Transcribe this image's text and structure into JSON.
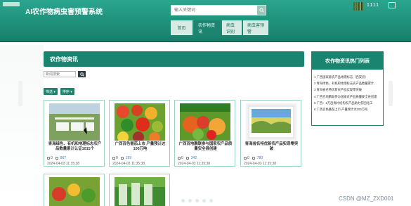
{
  "header": {
    "title": "AI农作物病虫害预警系统",
    "search_placeholder": "输入关键词",
    "username": "1111",
    "nav": [
      {
        "label": "首页",
        "active": false
      },
      {
        "label": "农作物资讯",
        "active": true
      },
      {
        "label": "病虫识别",
        "active": false
      },
      {
        "label": "病虫害预警",
        "active": false
      }
    ]
  },
  "main": {
    "section_title": "农作物资讯",
    "search_placeholder": "新闻搜索",
    "filters": [
      {
        "label": "筛选 ▾"
      },
      {
        "label": "排序 ▾"
      }
    ],
    "cards": [
      {
        "title": "青海绿色、有机和地理标志农产品数量累计认证1015个",
        "likes": "0",
        "views": "867",
        "date": "2024-04-03 11:35:38"
      },
      {
        "title": "广西百色番茄上市 产量预计达100万吨",
        "likes": "0",
        "views": "199",
        "date": "2024-04-03 11:35:38"
      },
      {
        "title": "广西百地鹏联参与国家农产品质量安全县创建",
        "likes": "0",
        "views": "342",
        "date": "2024-04-03 11:35:38"
      },
      {
        "title": "青海省名特优新农产品实现零突破",
        "likes": "0",
        "views": "780",
        "date": "2024-04-03 11:35:38"
      }
    ]
  },
  "sidebar": {
    "title": "农作物资讯热门列表",
    "items": [
      "1 广西国家级农产品地理标志（西安县）",
      "2 青海绿色、有机和地理标志农产品数量累计...",
      "3 青海省名特优新农产品实现零突破",
      "4 广西百地鹏联参与国家农产品质量安全县创建",
      "5 广西：2万亩梅片结构农产品助力贫困化工",
      "6 广西百色番茄上市 产量预计达100万吨"
    ]
  },
  "watermark": "CSDN @MZ_ZXD001",
  "colors": {
    "primary": "#1b8470",
    "header_gradient_start": "#2ba58e",
    "header_gradient_end": "#17806b",
    "link_blue": "#3a7fc4"
  }
}
